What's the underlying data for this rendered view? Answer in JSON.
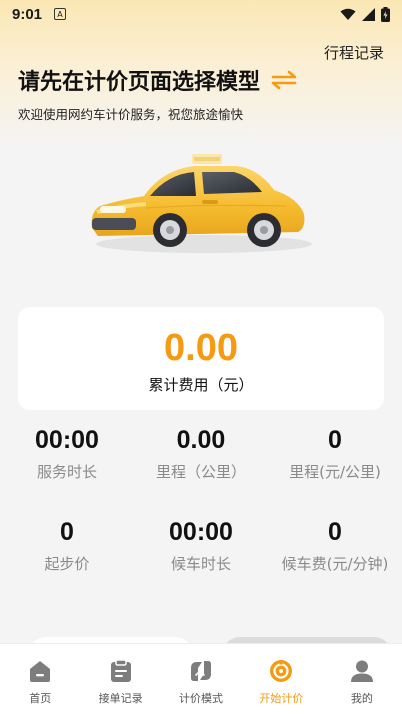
{
  "status_bar": {
    "time": "9:01",
    "badge": "A"
  },
  "header": {
    "trip_records": "行程记录",
    "title": "请先在计价页面选择模型",
    "subtitle": "欢迎使用网约车计价服务，祝您旅途愉快"
  },
  "fee": {
    "value": "0.00",
    "label": "累计费用（元）"
  },
  "stats": [
    {
      "value": "00:00",
      "label": "服务时长"
    },
    {
      "value": "0.00",
      "label": "里程（公里）"
    },
    {
      "value": "0",
      "label": "里程(元/公里)"
    },
    {
      "value": "0",
      "label": "起步价"
    },
    {
      "value": "00:00",
      "label": "候车时长"
    },
    {
      "value": "0",
      "label": "候车费(元/分钟)"
    }
  ],
  "tabs": [
    {
      "label": "首页",
      "icon": "home-icon"
    },
    {
      "label": "接单记录",
      "icon": "clipboard-icon"
    },
    {
      "label": "计价模式",
      "icon": "mode-icon"
    },
    {
      "label": "开始计价",
      "icon": "start-icon",
      "active": true
    },
    {
      "label": "我的",
      "icon": "user-icon"
    }
  ],
  "colors": {
    "accent": "#f59a11",
    "icon_gray": "#7d7d7d",
    "car_yellow": "#f8c43c"
  }
}
